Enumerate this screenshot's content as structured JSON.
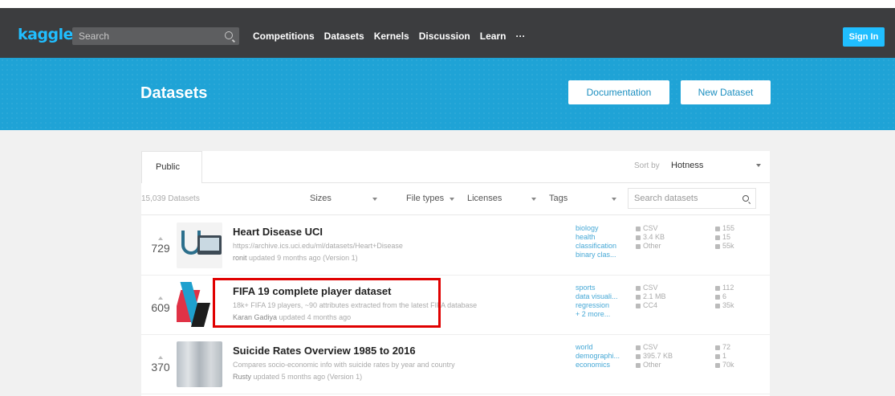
{
  "nav": {
    "logo": "kaggle",
    "search_placeholder": "Search",
    "links": [
      "Competitions",
      "Datasets",
      "Kernels",
      "Discussion",
      "Learn",
      "···"
    ],
    "signin_label": "Sign In"
  },
  "header": {
    "title": "Datasets",
    "documentation_label": "Documentation",
    "new_dataset_label": "New Dataset",
    "accent_color": "#1fa3d6"
  },
  "listing": {
    "tab_label": "Public",
    "sort_label": "Sort by",
    "sort_value": "Hotness",
    "dataset_count": "15,039 Datasets",
    "filters": [
      "Sizes",
      "File types",
      "Licenses",
      "Tags"
    ],
    "search_placeholder": "Search datasets"
  },
  "datasets": [
    {
      "votes": "729",
      "title": "Heart Disease UCI",
      "subtitle": "https://archive.ics.uci.edu/ml/datasets/Heart+Disease",
      "author": "ronit",
      "updated": "updated 9 months ago (Version 1)",
      "tags": [
        "biology",
        "health",
        "classification",
        "binary clas..."
      ],
      "format": [
        "CSV",
        "3.4 KB",
        "Other"
      ],
      "stats": [
        "155",
        "15",
        "55k"
      ]
    },
    {
      "votes": "609",
      "title": "FIFA 19 complete player dataset",
      "subtitle": "18k+ FIFA 19 players, ~90 attributes extracted from the latest FIFA database",
      "author": "Karan Gadiya",
      "updated": "updated 4 months ago",
      "tags": [
        "sports",
        "data visuali...",
        "regression",
        "+ 2 more..."
      ],
      "format": [
        "CSV",
        "2.1 MB",
        "CC4"
      ],
      "stats": [
        "112",
        "6",
        "35k"
      ]
    },
    {
      "votes": "370",
      "title": "Suicide Rates Overview 1985 to 2016",
      "subtitle": "Compares socio-economic info with suicide rates by year and country",
      "author": "Rusty",
      "updated": "updated 5 months ago (Version 1)",
      "tags": [
        "world",
        "demographi...",
        "economics"
      ],
      "format": [
        "CSV",
        "395.7 KB",
        "Other"
      ],
      "stats": [
        "72",
        "1",
        "70k"
      ]
    }
  ]
}
